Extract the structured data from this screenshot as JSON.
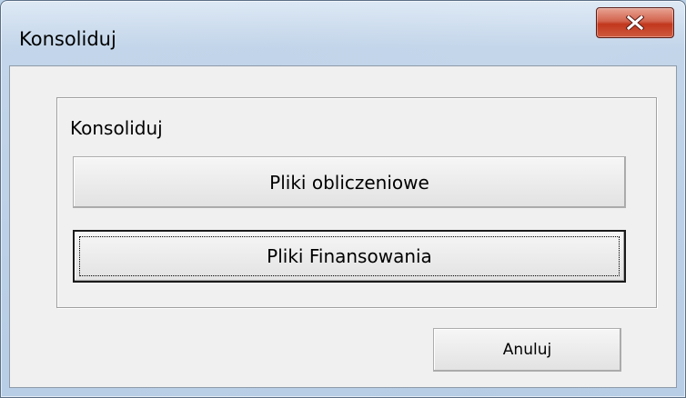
{
  "window": {
    "title": "Konsoliduj",
    "close_icon": "close-icon"
  },
  "group": {
    "label": "Konsoliduj"
  },
  "buttons": {
    "obliczeniowe": "Pliki obliczeniowe",
    "finansowania": "Pliki Finansowania",
    "cancel": "Anuluj"
  },
  "colors": {
    "client_background": "#f0f0f0",
    "close_button": "#c1371d",
    "title_bar": "#b8cee6"
  }
}
